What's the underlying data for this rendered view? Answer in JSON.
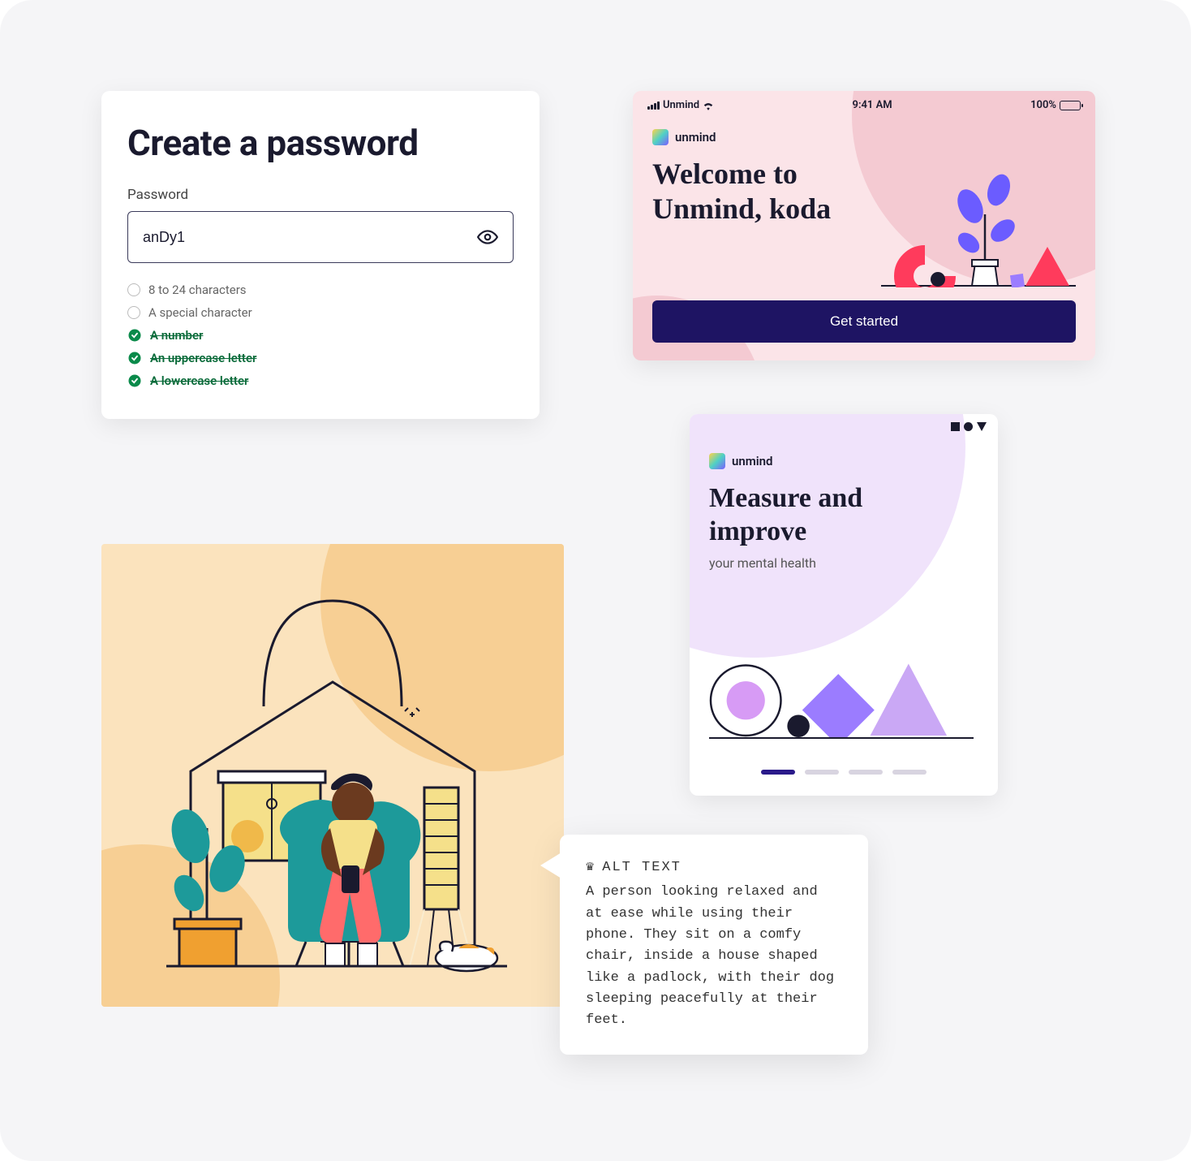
{
  "password_card": {
    "title": "Create a password",
    "label": "Password",
    "value": "anDy1",
    "rules": [
      {
        "text": "8 to 24 characters",
        "met": false
      },
      {
        "text": "A special character",
        "met": false
      },
      {
        "text": "A number",
        "met": true
      },
      {
        "text": "An uppercase letter",
        "met": true
      },
      {
        "text": "A lowercase letter",
        "met": true
      }
    ]
  },
  "welcome_card": {
    "status": {
      "carrier": "Unmind",
      "time": "9:41 AM",
      "battery": "100%"
    },
    "brand": "unmind",
    "title_line1": "Welcome to",
    "title_line2": "Unmind, koda",
    "cta": "Get started"
  },
  "measure_card": {
    "brand": "unmind",
    "title_line1": "Measure and",
    "title_line2": "improve",
    "subtitle": "your mental health",
    "active_dot": 0,
    "total_dots": 4
  },
  "alt_text": {
    "label": "ALT TEXT",
    "body": "A person looking relaxed and at ease while using their phone. They sit on a comfy chair, inside a house shaped like a padlock, with their dog sleeping peacefully at their feet."
  },
  "colors": {
    "navy": "#1e1463",
    "green": "#0a6b3a",
    "pink_bg": "#fbe4e8",
    "lilac_bg": "#f0e3fb",
    "peach_bg": "#fbe3bd"
  }
}
